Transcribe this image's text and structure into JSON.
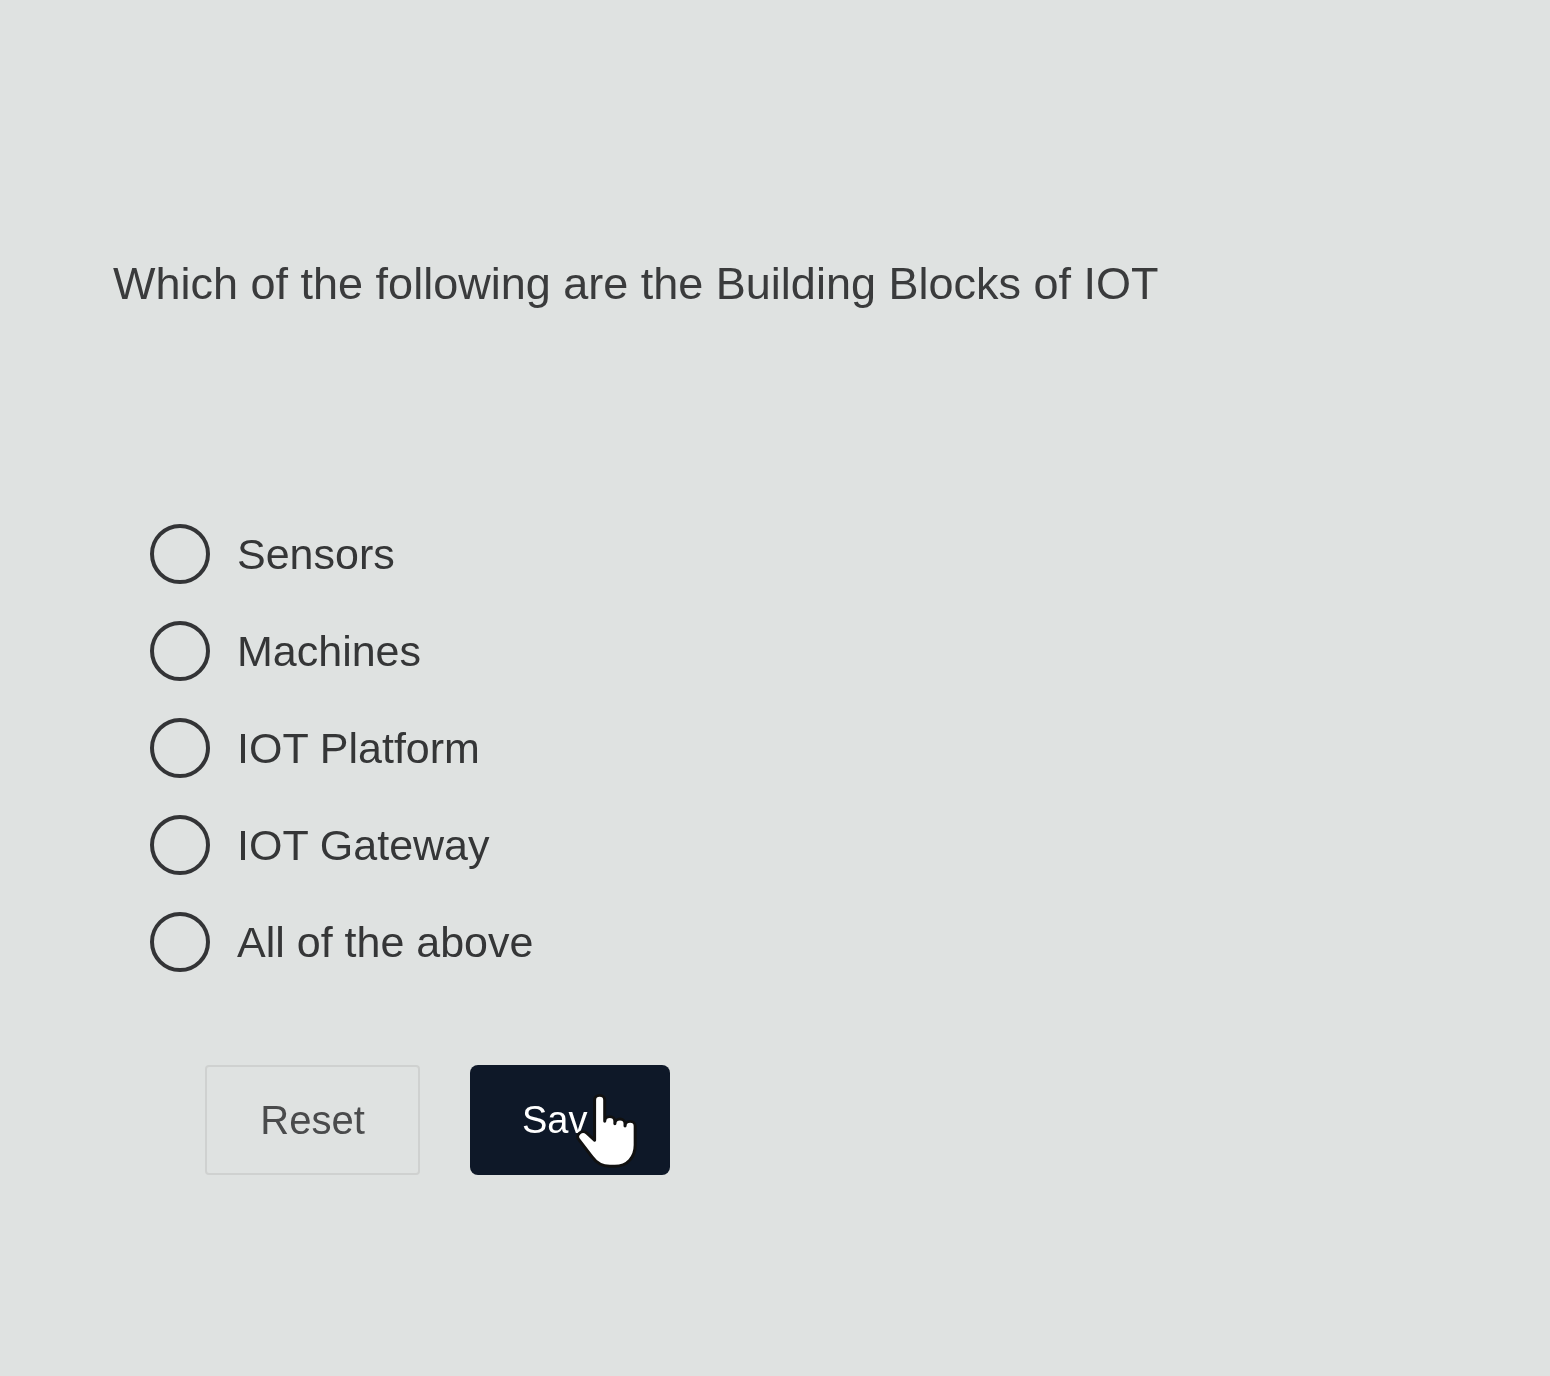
{
  "question": {
    "text": "Which of the following are the Building Blocks of IOT"
  },
  "options": [
    {
      "label": "Sensors",
      "selected": false
    },
    {
      "label": "Machines",
      "selected": false
    },
    {
      "label": "IOT Platform",
      "selected": false
    },
    {
      "label": "IOT Gateway",
      "selected": false
    },
    {
      "label": "All of the above",
      "selected": false
    }
  ],
  "buttons": [
    {
      "label": "Reset",
      "kind": "secondary"
    },
    {
      "label": "Sav",
      "kind": "primary"
    }
  ]
}
